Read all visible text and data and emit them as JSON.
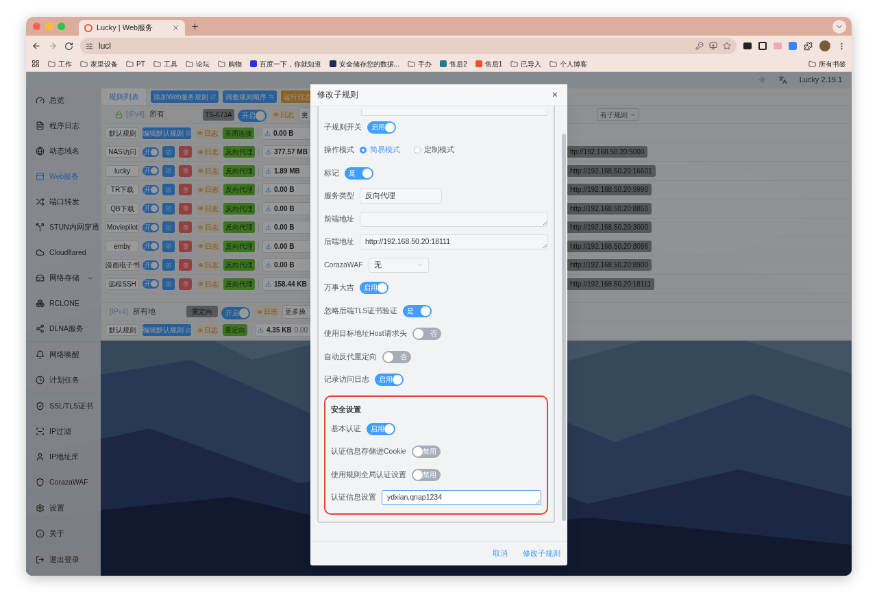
{
  "browser": {
    "tab_title": "Lucky | Web服务",
    "url": "lucl",
    "bookmarks": [
      {
        "label": "工作",
        "kind": "folder"
      },
      {
        "label": "家里设备",
        "kind": "folder"
      },
      {
        "label": "PT",
        "kind": "folder"
      },
      {
        "label": "工具",
        "kind": "folder"
      },
      {
        "label": "论坛",
        "kind": "folder"
      },
      {
        "label": "购物",
        "kind": "folder"
      },
      {
        "label": "百度一下，你就知道",
        "kind": "site",
        "color": "#2932e1"
      },
      {
        "label": "安全储存您的数据...",
        "kind": "site",
        "color": "#1e2a5a"
      },
      {
        "label": "手办",
        "kind": "folder"
      },
      {
        "label": "售后2",
        "kind": "site",
        "color": "#1d7d8c"
      },
      {
        "label": "售后1",
        "kind": "site",
        "color": "#f25022"
      },
      {
        "label": "已导入",
        "kind": "folder"
      },
      {
        "label": "个人博客",
        "kind": "folder"
      }
    ],
    "all_bookmarks": "所有书签"
  },
  "app": {
    "version": "Lucky 2.19.1"
  },
  "sidebar": {
    "groups": [
      [
        {
          "label": "总览",
          "selected": false,
          "has_submenu": false
        },
        {
          "label": "程序日志",
          "selected": false,
          "has_submenu": false
        },
        {
          "label": "动态域名",
          "selected": false,
          "has_submenu": false
        },
        {
          "label": "Web服务",
          "selected": true,
          "has_submenu": false
        },
        {
          "label": "端口转发",
          "selected": false,
          "has_submenu": false
        },
        {
          "label": "STUN内网穿透",
          "selected": false,
          "has_submenu": false
        },
        {
          "label": "Cloudflared",
          "selected": false,
          "has_submenu": false
        },
        {
          "label": "网络存储",
          "selected": false,
          "has_submenu": true
        },
        {
          "label": "RCLONE",
          "selected": false,
          "has_submenu": false
        },
        {
          "label": "DLNA服务",
          "selected": false,
          "has_submenu": false
        }
      ],
      [
        {
          "label": "网络唤醒",
          "selected": false,
          "has_submenu": false
        },
        {
          "label": "计划任务",
          "selected": false,
          "has_submenu": false
        }
      ],
      [
        {
          "label": "SSL/TLS证书",
          "selected": false,
          "has_submenu": false
        },
        {
          "label": "IP过滤",
          "selected": false,
          "has_submenu": false
        },
        {
          "label": "IP地址库",
          "selected": false,
          "has_submenu": false
        },
        {
          "label": "CorazaWAF",
          "selected": false,
          "has_submenu": false
        }
      ],
      [
        {
          "label": "设置",
          "selected": false,
          "has_submenu": false
        },
        {
          "label": "关于",
          "selected": false,
          "has_submenu": false
        }
      ],
      [
        {
          "label": "退出登录",
          "selected": false,
          "has_submenu": false
        }
      ]
    ]
  },
  "content": {
    "tabs": [
      {
        "label": "规则列表",
        "selected": true
      }
    ],
    "buttons": [
      {
        "label": "添加Web服务规则",
        "kind": "primary"
      },
      {
        "label": "调整规则顺序",
        "kind": "primary"
      },
      {
        "label": "运行日志",
        "kind": "warning"
      }
    ],
    "rule_groups": [
      {
        "locked": true,
        "protocol": "[IPv4]",
        "address": "所有",
        "badge": "TS-673A",
        "switch": {
          "label": "开启",
          "on": true
        },
        "log": "日志",
        "more": "更",
        "filter": "有子规则",
        "rows": [
          {
            "kind": "default",
            "name": "默认规则",
            "edit": "编辑默认规则",
            "log": "日志",
            "type": "关闭连接",
            "traffic": "0.00 B"
          },
          {
            "kind": "sub",
            "name": "NAS访问",
            "switch": {
              "label": "开",
              "on": true
            },
            "log": "日志",
            "type": "反向代理",
            "traffic": "377.57 MB",
            "target": "ttp://192.168.50.20:5000"
          },
          {
            "kind": "sub",
            "name": "lucky",
            "switch": {
              "label": "开",
              "on": true
            },
            "log": "日志",
            "type": "反向代理",
            "traffic": "1.89 MB",
            "target": "http://192.168.50.20:16601"
          },
          {
            "kind": "sub",
            "name": "TR下载",
            "switch": {
              "label": "开",
              "on": true
            },
            "log": "日志",
            "type": "反向代理",
            "traffic": "0.00 B",
            "target": "http://192.168.50.20:9990"
          },
          {
            "kind": "sub",
            "name": "QB下载",
            "switch": {
              "label": "开",
              "on": true
            },
            "log": "日志",
            "type": "反向代理",
            "traffic": "0.00 B",
            "target": "http://192.168.50.20:8850"
          },
          {
            "kind": "sub",
            "name": "Moviepilot",
            "switch": {
              "label": "开",
              "on": true
            },
            "log": "日志",
            "type": "反向代理",
            "traffic": "0.00 B",
            "target": "http://192.168.50.20:3000"
          },
          {
            "kind": "sub",
            "name": "emby",
            "switch": {
              "label": "开",
              "on": true
            },
            "log": "日志",
            "type": "反向代理",
            "traffic": "0.00 B",
            "target": "http://192.168.50.20:8096"
          },
          {
            "kind": "sub",
            "name": "漫画电子书",
            "switch": {
              "label": "开",
              "on": true
            },
            "log": "日志",
            "type": "反向代理",
            "traffic": "0.00 B",
            "target": "http://192.168.50.20:8900"
          },
          {
            "kind": "sub",
            "name": "远程SSH",
            "switch": {
              "label": "开",
              "on": true
            },
            "log": "日志",
            "type": "反向代理",
            "traffic": "158.44 KB",
            "target": "http://192.168.50.20:18111"
          }
        ]
      },
      {
        "locked": false,
        "protocol": "[IPv4]",
        "address": "所有地",
        "badge": "重定向",
        "switch": {
          "label": "开启",
          "on": true
        },
        "log": "日志",
        "more": "更多操",
        "rows": [
          {
            "kind": "default",
            "name": "默认规则",
            "edit": "编辑默认规则",
            "log": "日志",
            "type": "重定向",
            "traffic": "4.35 KB",
            "traffic_extra": "0.00"
          }
        ]
      }
    ]
  },
  "modal": {
    "title": "修改子规则",
    "close": "×",
    "fields": [
      {
        "kind": "switch",
        "label": "子规则开关",
        "text": "启用",
        "on": true
      },
      {
        "kind": "radio",
        "label": "操作模式",
        "options": [
          {
            "label": "简易模式",
            "selected": true
          },
          {
            "label": "定制模式",
            "selected": false
          }
        ]
      },
      {
        "kind": "switch",
        "label": "标记",
        "text": "是",
        "on": true
      },
      {
        "kind": "text",
        "label": "服务类型",
        "value": "反向代理"
      },
      {
        "kind": "textarea",
        "label": "前端地址",
        "focused": false
      },
      {
        "kind": "textarea",
        "label": "后端地址",
        "value": "http://192.168.50.20:18111",
        "focused": false
      },
      {
        "kind": "select",
        "label": "CorazaWAF",
        "value": "无"
      },
      {
        "kind": "switch",
        "label": "万事大吉",
        "text": "启用",
        "on": true
      },
      {
        "kind": "switch",
        "label": "忽略后端TLS证书验证",
        "text": "是",
        "on": true
      },
      {
        "kind": "switch",
        "label": "使用目标地址Host请求头",
        "text": "否",
        "on": false
      },
      {
        "kind": "switch",
        "label": "自动反代重定向",
        "text": "否",
        "on": false
      },
      {
        "kind": "switch",
        "label": "记录访问日志",
        "text": "启用",
        "on": true
      }
    ],
    "security": {
      "title": "安全设置",
      "highlighted": true,
      "fields": [
        {
          "kind": "switch",
          "label": "基本认证",
          "text": "启用",
          "on": true
        },
        {
          "kind": "switch",
          "label": "认证信息存储进Cookie",
          "text": "禁用",
          "on": false
        },
        {
          "kind": "switch",
          "label": "使用规则全局认证设置",
          "text": "禁用",
          "on": false
        },
        {
          "kind": "textarea",
          "label": "认证信息设置",
          "value": "ydxian,qnap1234",
          "focused": true
        }
      ]
    },
    "buttons": [
      {
        "label": "取消"
      },
      {
        "label": "修改子规则"
      }
    ]
  }
}
